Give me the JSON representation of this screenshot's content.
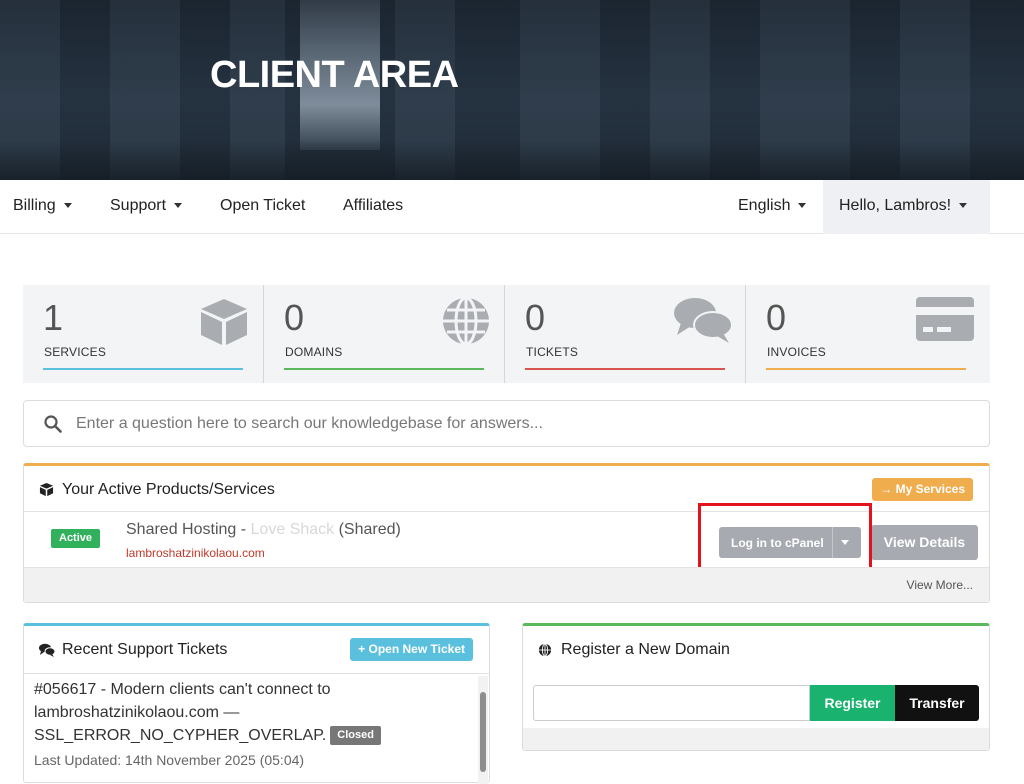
{
  "hero": {
    "title": "CLIENT AREA"
  },
  "nav": {
    "billing": "Billing",
    "support": "Support",
    "open_ticket": "Open Ticket",
    "affiliates": "Affiliates",
    "language": "English",
    "user": "Hello, Lambros!"
  },
  "stats": [
    {
      "value": "1",
      "label": "SERVICES",
      "color": "#5bc0de",
      "icon": "cube-icon"
    },
    {
      "value": "0",
      "label": "DOMAINS",
      "color": "#5cb85c",
      "icon": "globe-icon"
    },
    {
      "value": "0",
      "label": "TICKETS",
      "color": "#d9534f",
      "icon": "comments-icon"
    },
    {
      "value": "0",
      "label": "INVOICES",
      "color": "#f0ad4e",
      "icon": "credit-card-icon"
    }
  ],
  "search": {
    "placeholder": "Enter a question here to search our knowledgebase for answers..."
  },
  "products": {
    "title": "Your Active Products/Services",
    "my_services": "→ My Services",
    "status": "Active",
    "service_name_a": "Shared Hosting - ",
    "service_name_b": "Love Shack",
    "service_name_c": " (Shared)",
    "domain": "lambroshatzinikolaou.com",
    "cpanel_button": "Log in to cPanel",
    "view_details": "View Details",
    "view_more": "View More..."
  },
  "tickets": {
    "title": "Recent Support Tickets",
    "open_new": "+ Open New Ticket",
    "items": [
      {
        "subject": "#056617 - Modern clients can't connect to lambroshatzinikolaou.com — SSL_ERROR_NO_CYPHER_OVERLAP.",
        "status": "Closed",
        "updated": "Last Updated: 14th November 2025 (05:04)"
      }
    ]
  },
  "domain_panel": {
    "title": "Register a New Domain",
    "register": "Register",
    "transfer": "Transfer"
  },
  "colors": {
    "accent_orange": "#f0ad4e",
    "accent_blue": "#5bc0de",
    "accent_green": "#5cb85c",
    "highlight_red": "#e3121b"
  }
}
